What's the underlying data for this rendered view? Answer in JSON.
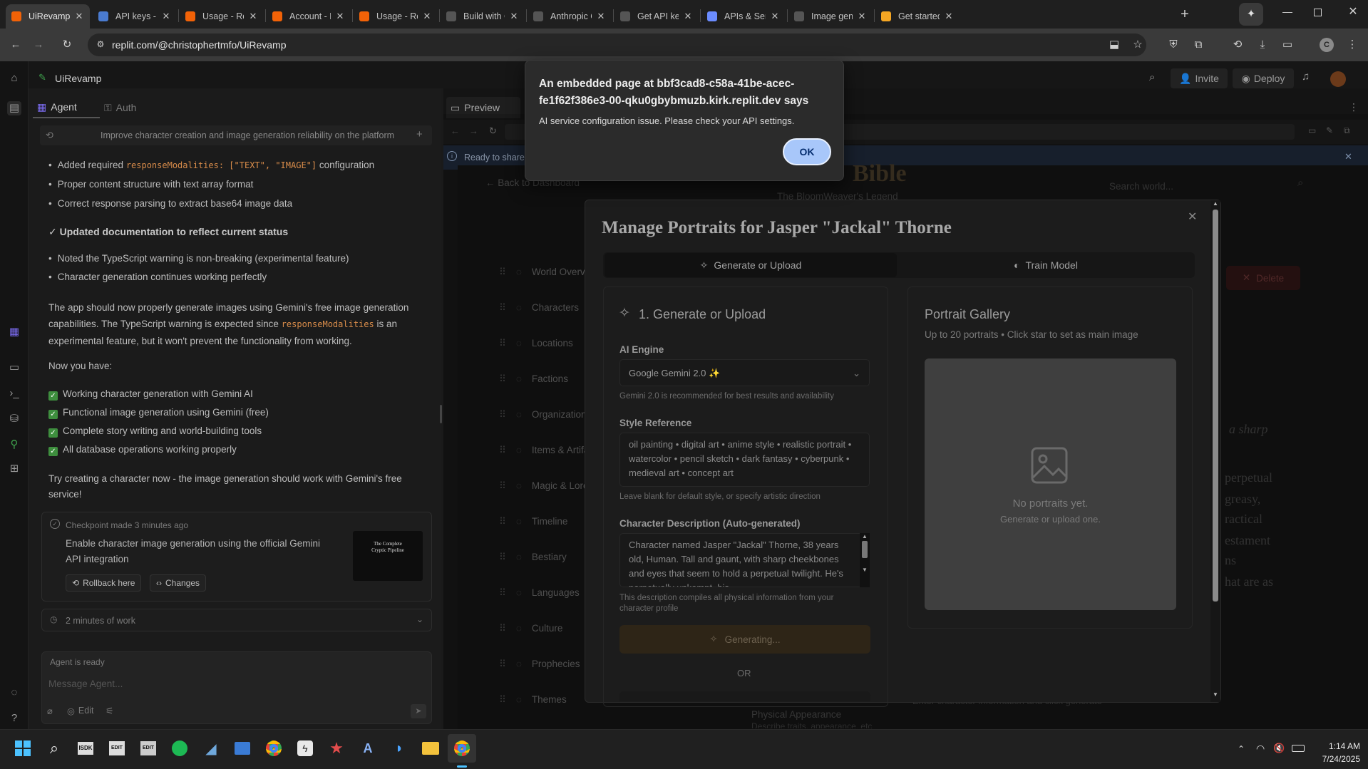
{
  "browser": {
    "tabs": [
      {
        "title": "UiRevamp - Re",
        "icon": "replit-icon",
        "color": "#f26207",
        "active": true
      },
      {
        "title": "API keys - Ope",
        "icon": "openai-icon",
        "color": "#4a7bd0",
        "active": false
      },
      {
        "title": "Usage - Replit",
        "icon": "replit-icon",
        "color": "#f26207",
        "active": false
      },
      {
        "title": "Account - Repl",
        "icon": "replit-icon",
        "color": "#f26207",
        "active": false
      },
      {
        "title": "Usage - Replit",
        "icon": "replit-icon",
        "color": "#f26207",
        "active": false
      },
      {
        "title": "Build with Clau",
        "icon": "anthropic-icon",
        "color": "#ffffff",
        "active": false
      },
      {
        "title": "Anthropic Con",
        "icon": "anthropic-icon",
        "color": "#ffffff",
        "active": false
      },
      {
        "title": "Get API key | G",
        "icon": "google-ai-icon",
        "color": "#ffffff",
        "active": false
      },
      {
        "title": "APIs & Service",
        "icon": "api-icon",
        "color": "#6b8cff",
        "active": false
      },
      {
        "title": "Image generat",
        "icon": "google-icon",
        "color": "#ffffff",
        "active": false
      },
      {
        "title": "Get started - F",
        "icon": "firebase-icon",
        "color": "#f5a623",
        "active": false
      }
    ],
    "url": "replit.com/@christophertmfo/UiRevamp"
  },
  "app": {
    "project_name": "UiRevamp",
    "invite_label": "Invite",
    "deploy_label": "Deploy",
    "tabs": {
      "agent": "Agent",
      "auth": "Auth",
      "preview": "Preview"
    },
    "agent_header": "Improve character creation and image generation reliability on the platform"
  },
  "agent": {
    "bullets1": [
      {
        "pre": "Added required ",
        "code": "responseModalities: [\"TEXT\", \"IMAGE\"]",
        "post": " configuration"
      },
      {
        "pre": "Proper content structure with text array format",
        "code": "",
        "post": ""
      },
      {
        "pre": "Correct response parsing to extract base64 image data",
        "code": "",
        "post": ""
      }
    ],
    "heading": "✓ Updated documentation to reflect current status",
    "bullets2": [
      "Noted the TypeScript warning is non-breaking (experimental feature)",
      "Character generation continues working perfectly"
    ],
    "para1_a": "The app should now properly generate images using Gemini's free image generation",
    "para1_b": "capabilities. The TypeScript warning is expected since ",
    "para1_code": "responseModalities",
    "para1_c": " is an",
    "para1_d": "experimental feature, but it won't prevent the functionality from working.",
    "now_you_have": "Now you have:",
    "checklist": [
      "Working character generation with Gemini AI",
      "Functional image generation using Gemini (free)",
      "Complete story writing and world-building tools",
      "All database operations working properly"
    ],
    "para2_a": "Try creating a character now - the image generation should work with Gemini's free",
    "para2_b": "service!",
    "checkpoint": {
      "meta": "Checkpoint made 3 minutes ago",
      "title_a": "Enable character image generation using the official Gemini",
      "title_b": "API integration",
      "rollback": "Rollback here",
      "changes": "Changes",
      "thumb_title_a": "The Complete",
      "thumb_title_b": "Cryptic Pipeline"
    },
    "work_label": "2 minutes of work",
    "status": "Agent is ready",
    "message_placeholder": "Message Agent...",
    "edit_label": "Edit"
  },
  "preview": {
    "ready_banner": "Ready to share",
    "back_link": "← Back to Dashboard",
    "page_title": "Bible",
    "page_subtitle": "The BloomWeaver's Legend",
    "search_placeholder": "Search world...",
    "delete_label": "Delete",
    "sidebar": [
      "World Overview",
      "Characters",
      "Locations",
      "Factions",
      "Organizations",
      "Items & Artifacts",
      "Magic & Lore",
      "Timeline",
      "Bestiary",
      "Languages",
      "Culture",
      "Prophecies",
      "Themes"
    ],
    "bg_text": [
      "a sharp",
      "perpetual",
      "greasy,",
      "ractical",
      "estament",
      "ns",
      "hat are as"
    ],
    "physical_appearance": "Physical Appearance",
    "physical_sub": "Describe traits, appearance, etc",
    "footer_text": "Enter character information and click generate"
  },
  "modal": {
    "title": "Manage Portraits for Jasper \"Jackal\" Thorne",
    "tab_generate": "Generate or Upload",
    "tab_train": "Train Model",
    "section_title": "1. Generate or Upload",
    "engine_label": "AI Engine",
    "engine_value": "Google Gemini 2.0 ✨",
    "engine_hint": "Gemini 2.0 is recommended for best results and availability",
    "style_label": "Style Reference",
    "style_value": "oil painting • digital art • anime style • realistic portrait • watercolor • pencil sketch • dark fantasy • cyberpunk • medieval art • concept art",
    "style_hint": "Leave blank for default style, or specify artistic direction",
    "desc_label": "Character Description (Auto-generated)",
    "desc_value": "Character named Jasper \"Jackal\" Thorne, 38 years old, Human. Tall and gaunt, with sharp cheekbones and eyes that seem to hold a perpetual twilight. He's perpetually unkempt, his",
    "desc_hint": "This description compiles all physical information from your character profile",
    "generating_label": "Generating...",
    "or_label": "OR",
    "gallery_title": "Portrait Gallery",
    "gallery_sub": "Up to 20 portraits • Click star to set as main image",
    "empty_title": "No portraits yet.",
    "empty_sub": "Generate or upload one."
  },
  "alert": {
    "title_a": "An embedded page at bbf3cad8-c58a-41be-acec-",
    "title_b": "fe1f62f386e3-00-qku0gbybmuzb.kirk.replit.dev says",
    "message": "AI service configuration issue. Please check your API settings.",
    "ok_label": "OK"
  },
  "taskbar": {
    "time": "1:14 AM",
    "date": "7/24/2025"
  }
}
